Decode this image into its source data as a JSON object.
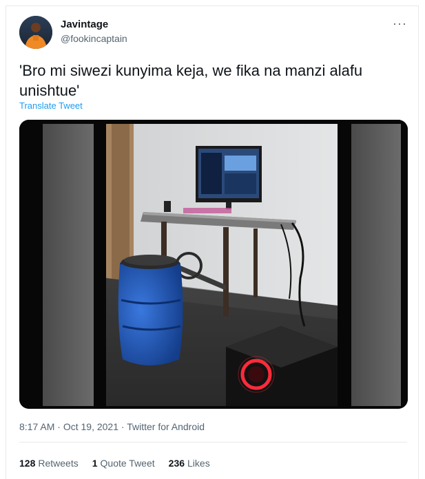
{
  "author": {
    "name": "Javintage",
    "handle": "@fookincaptain"
  },
  "more_label": "···",
  "tweet": {
    "text": "'Bro mi siwezi kunyima keja, we fika na manzi alafu unishtue'",
    "translate_label": "Translate Tweet"
  },
  "meta": {
    "time": "8:17 AM",
    "sep1": " · ",
    "date": "Oct 19, 2021",
    "sep2": " · ",
    "source": "Twitter for Android"
  },
  "stats": {
    "retweets_count": "128",
    "retweets_label": "Retweets",
    "quotes_count": "1",
    "quotes_label": "Quote Tweet",
    "likes_count": "236",
    "likes_label": "Likes"
  },
  "colors": {
    "link": "#1d9bf0",
    "secondary_text": "#536471",
    "primary_text": "#0f1419",
    "barrel": "#1f56b8",
    "speaker_ring": "#ff2a3a"
  }
}
